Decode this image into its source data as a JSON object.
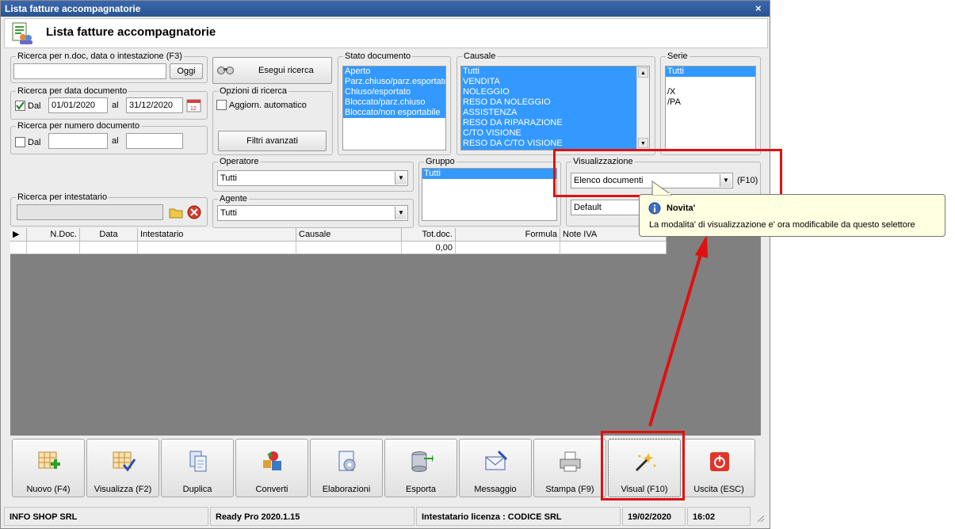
{
  "window": {
    "title": "Lista fatture accompagnatorie",
    "close": "×"
  },
  "header": {
    "title": "Lista fatture accompagnatorie",
    "icon": "document-list-icon"
  },
  "search_text": {
    "legend": "Ricerca per n.doc, data o intestazione (F3)",
    "value": "",
    "today_button": "Oggi"
  },
  "search_button": {
    "label": "Esegui ricerca",
    "icon": "binoculars-icon"
  },
  "date_search": {
    "legend": "Ricerca per data documento",
    "from_label": "Dal",
    "from_checked": true,
    "from_value": "01/01/2020",
    "to_label": "al",
    "to_value": "31/12/2020",
    "calendar_icon": "calendar-icon"
  },
  "number_search": {
    "legend": "Ricerca per numero documento",
    "from_label": "Dal",
    "from_checked": false,
    "from_value": "",
    "to_label": "al",
    "to_value": ""
  },
  "search_options": {
    "legend": "Opzioni di ricerca",
    "auto_update_label": "Aggiorn. automatico",
    "auto_update_checked": false
  },
  "advanced_filters": {
    "label": "Filtri avanzati"
  },
  "holder_search": {
    "legend": "Ricerca per intestatario",
    "value": ""
  },
  "doc_state": {
    "legend": "Stato documento",
    "items": [
      "Aperto",
      "Parz.chiuso/parz.esportato",
      "Chiuso/esportato",
      "Bloccato/parz.chiuso",
      "Bloccato/non esportabile"
    ]
  },
  "causale": {
    "legend": "Causale",
    "items": [
      "Tutti",
      "VENDITA",
      "NOLEGGIO",
      "RESO DA NOLEGGIO",
      "ASSISTENZA",
      "RESO DA RIPARAZIONE",
      "C/TO VISIONE",
      "RESO DA C/TO VISIONE"
    ]
  },
  "serie": {
    "legend": "Serie",
    "items": [
      "Tutti",
      "",
      "/X",
      "/PA"
    ]
  },
  "operatore": {
    "legend": "Operatore",
    "value": "Tutti"
  },
  "agente": {
    "legend": "Agente",
    "value": "Tutti"
  },
  "gruppo": {
    "legend": "Gruppo",
    "items": [
      "Tutti"
    ]
  },
  "visualizzazione": {
    "legend": "Visualizzazione",
    "value": "Elenco documenti",
    "shortcut": "(F10)",
    "second_value": "Default"
  },
  "tooltip": {
    "icon": "info-icon",
    "title": "Novita'",
    "body": "La modalita' di visualizzazione e' ora modificabile da questo selettore"
  },
  "grid": {
    "columns": [
      "N.Doc.",
      "Data",
      "Intestatario",
      "Causale",
      "Tot.doc.",
      "Formula",
      "Note IVA"
    ],
    "row": [
      "",
      "",
      "",
      "",
      "0,00",
      "",
      ""
    ]
  },
  "toolbar": [
    {
      "label": "Nuovo (F4)",
      "icon": "grid-add-icon"
    },
    {
      "label": "Visualizza (F2)",
      "icon": "grid-check-icon"
    },
    {
      "label": "Duplica",
      "icon": "copy-icon"
    },
    {
      "label": "Converti",
      "icon": "convert-icon"
    },
    {
      "label": "Elaborazioni",
      "icon": "process-icon"
    },
    {
      "label": "Esporta",
      "icon": "database-export-icon"
    },
    {
      "label": "Messaggio",
      "icon": "envelope-icon"
    },
    {
      "label": "Stampa (F9)",
      "icon": "printer-icon"
    },
    {
      "label": "Visual (F10)",
      "icon": "magic-wand-icon"
    },
    {
      "label": "Uscita (ESC)",
      "icon": "power-icon"
    }
  ],
  "status": {
    "company": "INFO SHOP SRL",
    "version": "Ready Pro 2020.1.15",
    "license": "Intestatario licenza : CODICE SRL",
    "date": "19/02/2020",
    "time": "16:02"
  },
  "colors": {
    "selection": "#3399ff",
    "highlight": "#e01010",
    "titlebar": "#2a558f",
    "tooltip_bg": "#ffffe1"
  }
}
